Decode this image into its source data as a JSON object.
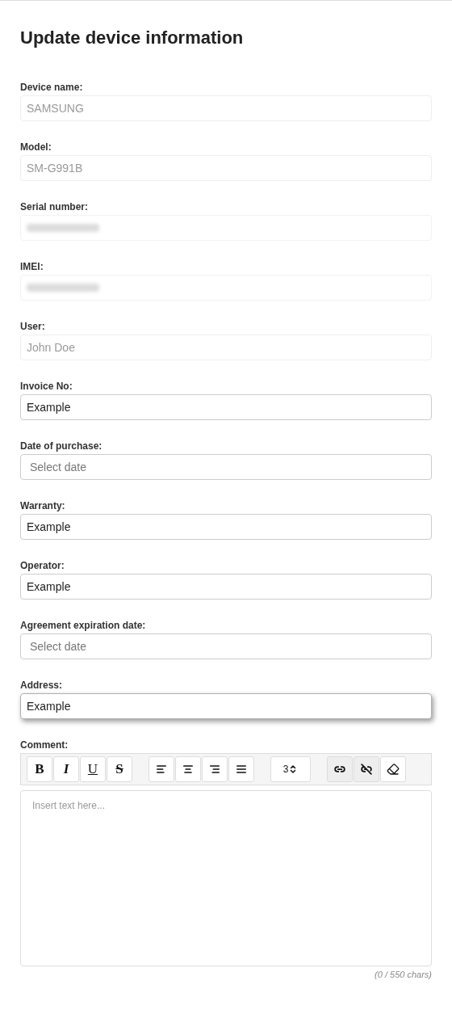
{
  "title": "Update device information",
  "fields": [
    {
      "label": "Device name:",
      "kind": "readonly",
      "value": "SAMSUNG",
      "focused": false
    },
    {
      "label": "Model:",
      "kind": "readonly",
      "value": "SM-G991B",
      "focused": false
    },
    {
      "label": "Serial number:",
      "kind": "redacted",
      "focused": false
    },
    {
      "label": "IMEI:",
      "kind": "redacted",
      "focused": false
    },
    {
      "label": "User:",
      "kind": "readonly",
      "value": "John Doe",
      "focused": false
    },
    {
      "label": "Invoice No:",
      "kind": "text",
      "value": "Example",
      "focused": false
    },
    {
      "label": "Date of purchase:",
      "kind": "date",
      "placeholder": "Select date",
      "focused": false
    },
    {
      "label": "Warranty:",
      "kind": "text",
      "value": "Example",
      "focused": false
    },
    {
      "label": "Operator:",
      "kind": "text",
      "value": "Example",
      "focused": false
    },
    {
      "label": "Agreement expiration date:",
      "kind": "date",
      "placeholder": "Select date",
      "focused": false
    },
    {
      "label": "Address:",
      "kind": "text",
      "value": "Example",
      "focused": true
    }
  ],
  "comment": {
    "label": "Comment:",
    "toolbar": [
      {
        "kind": "bold",
        "text": "B",
        "disabled": false
      },
      {
        "kind": "italic",
        "text": "I",
        "disabled": false
      },
      {
        "kind": "underline",
        "text": "U",
        "disabled": false
      },
      {
        "kind": "strike",
        "text": "S",
        "disabled": false
      },
      {
        "kind": "align-left",
        "disabled": false
      },
      {
        "kind": "align-center",
        "disabled": false
      },
      {
        "kind": "align-right",
        "disabled": false
      },
      {
        "kind": "justify",
        "disabled": false
      },
      {
        "kind": "size",
        "text": "3",
        "disabled": false
      },
      {
        "kind": "link",
        "disabled": true
      },
      {
        "kind": "unlink",
        "disabled": true
      },
      {
        "kind": "eraser",
        "disabled": false
      }
    ],
    "placeholder": "Insert text here...",
    "counter": "(0 / 550 chars)"
  }
}
